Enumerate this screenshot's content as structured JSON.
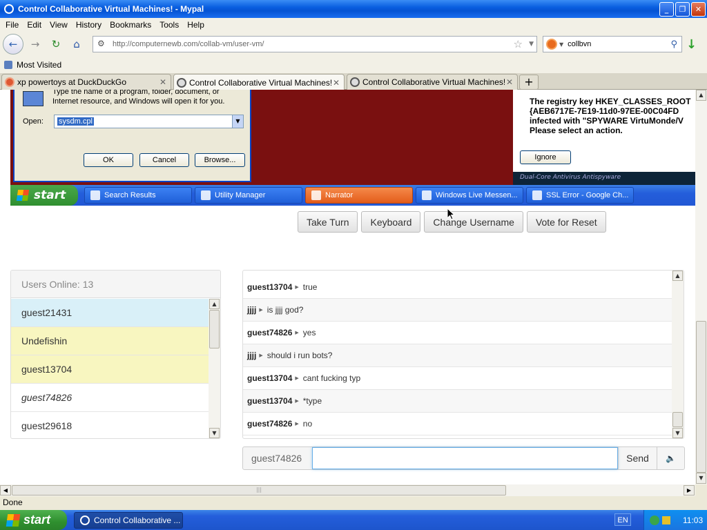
{
  "window": {
    "title": "Control Collaborative Virtual Machines! - Mypal",
    "buttons": [
      "_",
      "❐",
      "✕"
    ]
  },
  "menu": [
    "File",
    "Edit",
    "View",
    "History",
    "Bookmarks",
    "Tools",
    "Help"
  ],
  "nav": {
    "url": "http://computernewb.com/collab-vm/user-vm/",
    "search_query": "collbvn"
  },
  "bookmarks": {
    "most_visited": "Most Visited"
  },
  "tabs": [
    {
      "label": "xp powertoys at DuckDuckGo"
    },
    {
      "label": "Control Collaborative Virtual Machines!"
    },
    {
      "label": "Control Collaborative Virtual Machines!"
    }
  ],
  "vm": {
    "run_dialog": {
      "description": "Type the name of a program, folder, document, or Internet resource, and Windows will open it for you.",
      "open_label": "Open:",
      "open_value": "sysdm.cpl",
      "ok": "OK",
      "cancel": "Cancel",
      "browse": "Browse..."
    },
    "alert": {
      "text": "The registry key HKEY_CLASSES_ROOT\n{AEB6717E-7E19-11d0-97EE-00C04FD\ninfected with \"SPYWARE VirtuMonde/V\nPlease select an action.",
      "ignore": "Ignore",
      "brand": "Dual-Core Antivirus Antispyware"
    },
    "taskbar": {
      "start": "start",
      "tasks": [
        "Search Results",
        "Utility Manager",
        "Narrator",
        "Windows Live Messen...",
        "SSL Error - Google Ch..."
      ]
    }
  },
  "controls": [
    "Take Turn",
    "Keyboard",
    "Change Username",
    "Vote for Reset"
  ],
  "users": {
    "header": "Users Online: 13",
    "list": [
      "guest21431",
      "Undefishin",
      "guest13704",
      "guest74826",
      "guest29618"
    ]
  },
  "chat": {
    "messages": [
      {
        "user": "guest13704",
        "text": "true"
      },
      {
        "user": "jjjj",
        "text": "is jjjj god?"
      },
      {
        "user": "guest74826",
        "text": "yes"
      },
      {
        "user": "jjjj",
        "text": "should i run bots?"
      },
      {
        "user": "guest13704",
        "text": "cant fucking typ"
      },
      {
        "user": "guest13704",
        "text": "*type"
      },
      {
        "user": "guest74826",
        "text": "no"
      }
    ],
    "username": "guest74826",
    "input_value": "",
    "send": "Send"
  },
  "status": "Done",
  "host_taskbar": {
    "start": "start",
    "task": "Control Collaborative ...",
    "lang": "EN",
    "clock": "11:03"
  },
  "colors": {
    "vm_desktop": "#7a1010",
    "user_highlight_blue": "#d9f0f8",
    "user_highlight_yellow": "#f8f6c0",
    "xp_blue": "#245edb",
    "start_green": "#2f8f2f"
  }
}
